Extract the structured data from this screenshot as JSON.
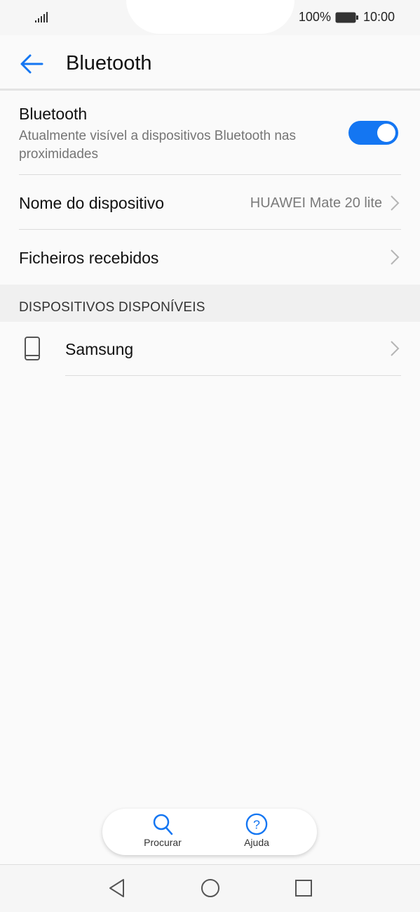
{
  "status_bar": {
    "battery_percent": "100%",
    "time": "10:00",
    "signal_icon": "signal-icon",
    "battery_icon": "battery-icon"
  },
  "header": {
    "title": "Bluetooth",
    "back_icon": "arrow-left-icon"
  },
  "bluetooth_row": {
    "title": "Bluetooth",
    "subtitle": "Atualmente visível a dispositivos Bluetooth nas proximidades",
    "toggle_on": true,
    "toggle_color": "#1476f2"
  },
  "device_name_row": {
    "title": "Nome do dispositivo",
    "value": "HUAWEI Mate 20 lite"
  },
  "received_files_row": {
    "title": "Ficheiros recebidos"
  },
  "available_devices": {
    "header": "DISPOSITIVOS DISPONÍVEIS",
    "items": [
      {
        "name": "Samsung",
        "icon": "phone-icon"
      }
    ]
  },
  "floating_bar": {
    "search_label": "Procurar",
    "help_label": "Ajuda",
    "accent": "#1476f2"
  },
  "nav_bar": {
    "back": "nav-back-icon",
    "home": "nav-home-icon",
    "recents": "nav-recents-icon"
  }
}
